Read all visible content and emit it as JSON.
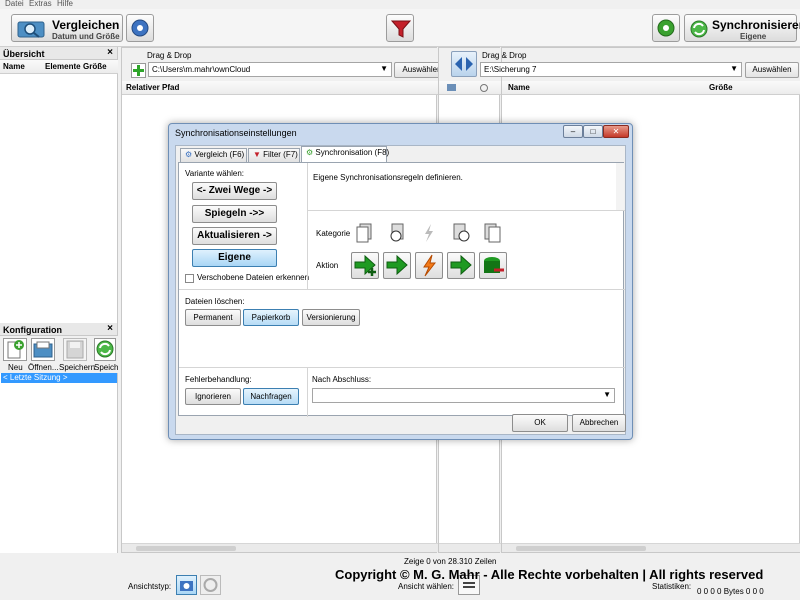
{
  "menu": [
    "Datei",
    "Extras",
    "Hilfe"
  ],
  "toolbar": {
    "compare_title": "Vergleichen",
    "compare_sub": "Datum und Größe",
    "sync_title": "Synchronisieren",
    "sync_sub": "Eigene"
  },
  "overview": {
    "title": "Übersicht",
    "close": "×",
    "columns": [
      "Name",
      "Elemente",
      "Größe"
    ]
  },
  "config": {
    "title": "Konfiguration",
    "close": "×",
    "buttons": [
      "Neu",
      "Öffnen...",
      "Speichern",
      "Speich"
    ],
    "last_session": "< Letzte Sitzung >"
  },
  "left": {
    "drag_label": "Drag & Drop",
    "path": "C:\\Users\\m.mahr\\ownCloud",
    "browse": "Auswählen",
    "col_path": "Relativer Pfad"
  },
  "right": {
    "drag_label": "Drag & Drop",
    "path": "E:\\Sicherung 7",
    "browse": "Auswählen",
    "col_name": "Name",
    "col_size": "Größe"
  },
  "dialog": {
    "title": "Synchronisationseinstellungen",
    "tabs": [
      "Vergleich (F6)",
      "Filter (F7)",
      "Synchronisation (F8)"
    ],
    "variant_label": "Variante wählen:",
    "variants": [
      "<- Zwei Wege ->",
      "Spiegeln ->>",
      "Aktualisieren ->",
      "Eigene"
    ],
    "moved_files": "Verschobene Dateien erkennen",
    "description": "Eigene Synchronisationsregeln definieren.",
    "category_label": "Kategorie",
    "action_label": "Aktion",
    "delete_label": "Dateien löschen:",
    "delete_options": [
      "Permanent",
      "Papierkorb",
      "Versionierung"
    ],
    "error_label": "Fehlerbehandlung:",
    "error_options": [
      "Ignorieren",
      "Nachfragen"
    ],
    "after_label": "Nach Abschluss:",
    "ok": "OK",
    "cancel": "Abbrechen"
  },
  "status": {
    "rows": "Zeige 0 von 28.310 Zeilen",
    "view_type": "Ansichtstyp:",
    "view_select": "Ansicht wählen:",
    "stats_label": "Statistiken:",
    "stats": "0 0 0 0 Bytes 0 0 0",
    "copyright": "Copyright © M. G. Mahr -  Alle Rechte vorbehalten | All rights reserved"
  },
  "colors": {
    "accent_blue": "#3c7fb1",
    "selection": "#3399ff",
    "dialog_frame": "#c9d9ee"
  }
}
